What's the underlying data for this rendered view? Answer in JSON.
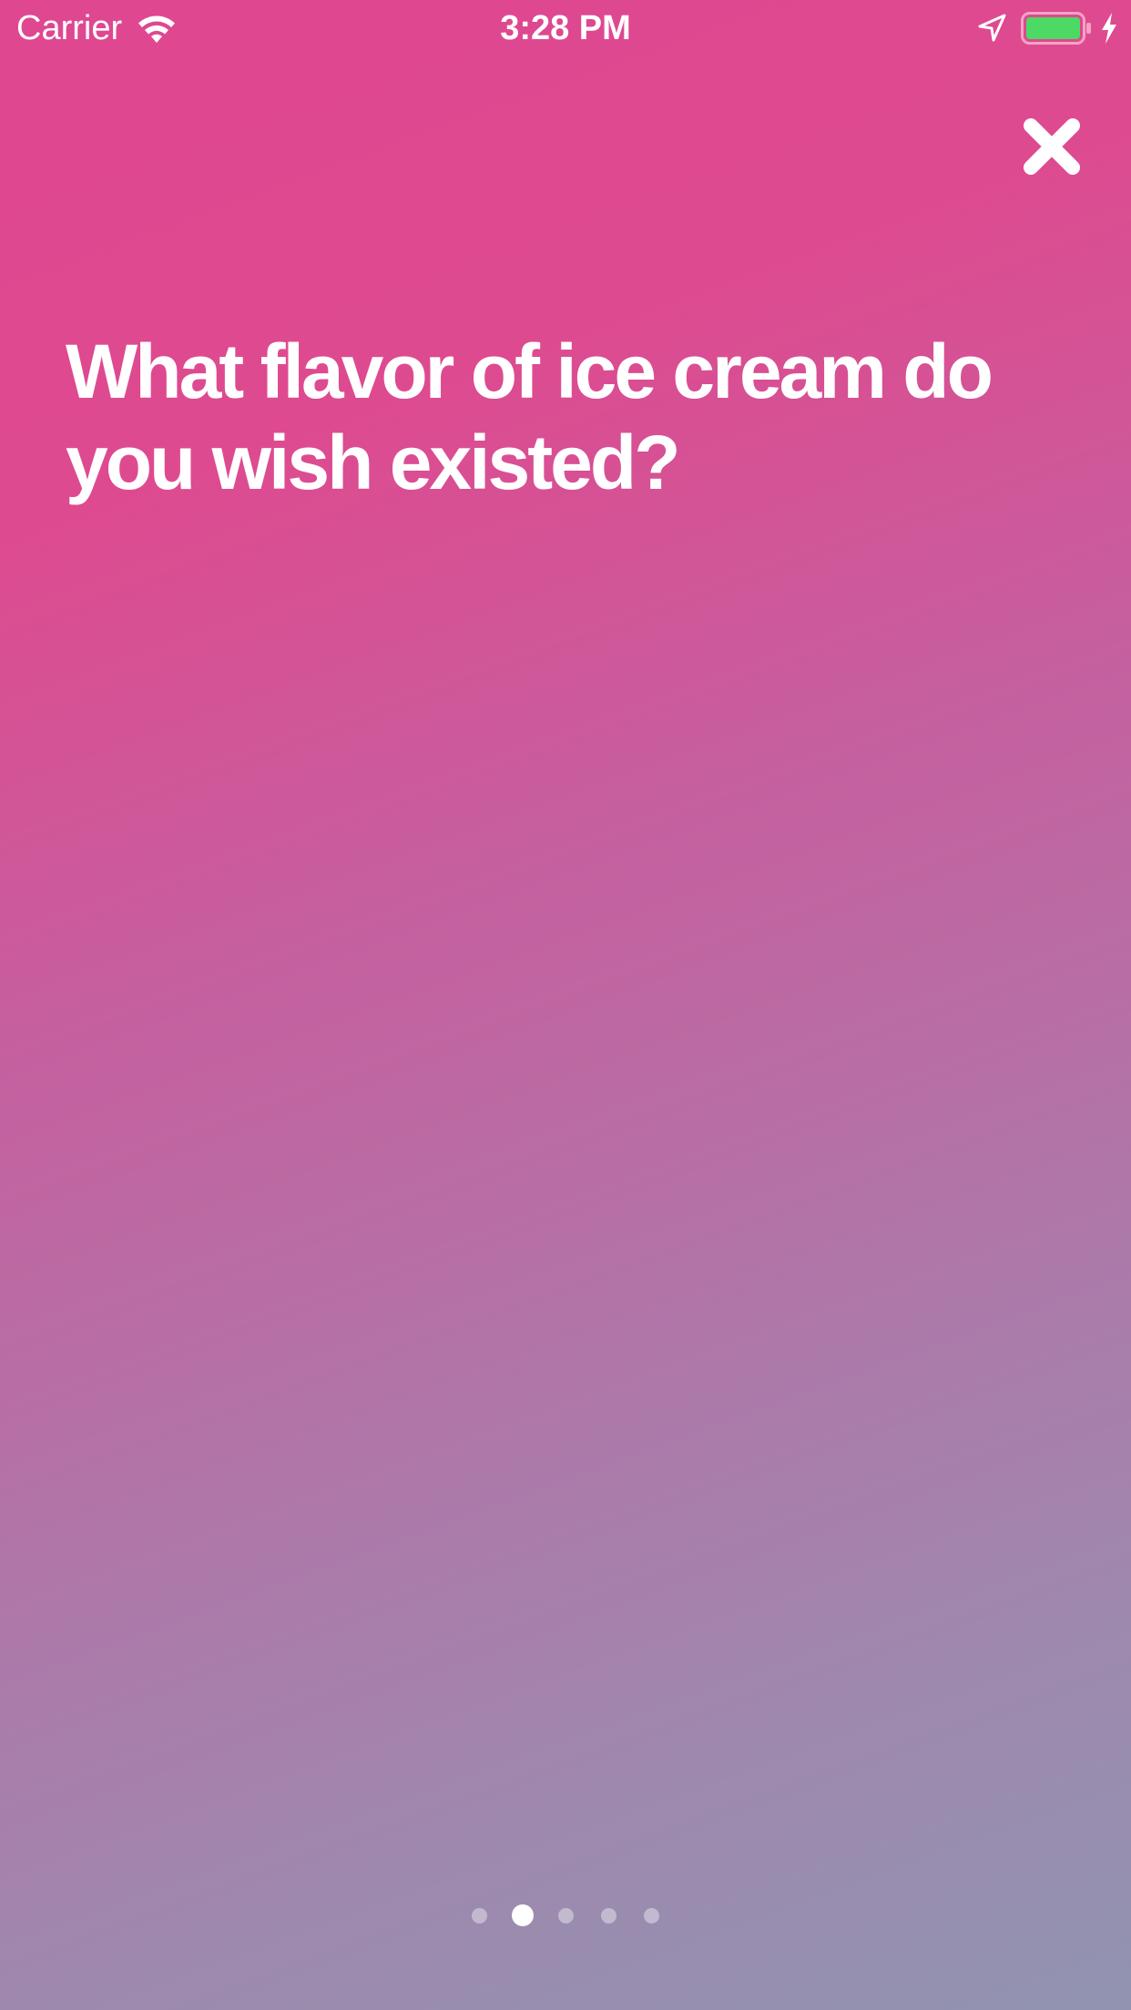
{
  "status_bar": {
    "carrier": "Carrier",
    "time": "3:28 PM",
    "battery_color": "#4cd964",
    "icons": [
      "wifi-icon",
      "location-arrow-icon",
      "battery-icon",
      "charging-bolt-icon"
    ]
  },
  "close": {
    "icon": "close-icon"
  },
  "card": {
    "question": "What flavor of ice cream do you wish existed?",
    "gradient_start": "#df4791",
    "gradient_end": "#9193b1"
  },
  "pagination": {
    "total": 5,
    "current": 2
  }
}
